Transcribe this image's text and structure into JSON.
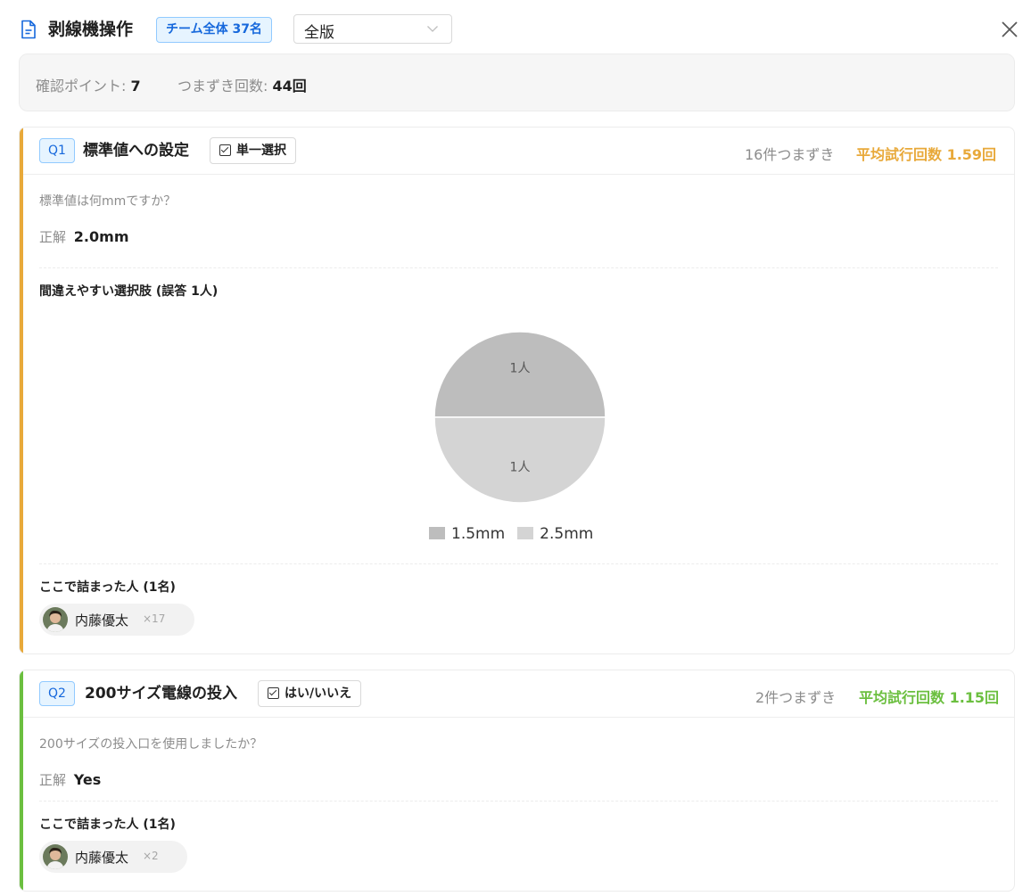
{
  "header": {
    "title": "剥線機操作",
    "team_badge": "チーム全体 37名",
    "version_select": {
      "selected": "全版"
    }
  },
  "summary": {
    "check_points_label": "確認ポイント:",
    "check_points_value": "7",
    "stumbles_label": "つまずき回数:",
    "stumbles_value": "44回"
  },
  "questions": [
    {
      "badge": "Q1",
      "title": "標準値への設定",
      "type_label": "単一選択",
      "stuck_count": "16件つまずき",
      "avg_attempts": "平均試行回数 1.59回",
      "accent_color": "#e8a93a",
      "question_text": "標準値は何mmですか？",
      "answer_label": "正解",
      "answer_value": "2.0mm",
      "confusing_title": "間違えやすい選択肢 (誤答 1人)",
      "stuck_people_title": "ここで詰まった人 (1名)",
      "people": [
        {
          "name": "内藤優太",
          "count": "×17"
        }
      ]
    },
    {
      "badge": "Q2",
      "title": "200サイズ電線の投入",
      "type_label": "はい/いいえ",
      "stuck_count": "2件つまずき",
      "avg_attempts": "平均試行回数 1.15回",
      "accent_color": "#6bbf3f",
      "question_text": "200サイズの投入口を使用しましたか？",
      "answer_label": "正解",
      "answer_value": "Yes",
      "stuck_people_title": "ここで詰まった人 (1名)",
      "people": [
        {
          "name": "内藤優太",
          "count": "×2"
        }
      ]
    }
  ],
  "chart_data": {
    "type": "pie",
    "categories": [
      "1.5mm",
      "2.5mm"
    ],
    "values": [
      1,
      1
    ],
    "data_labels": [
      "1人",
      "1人"
    ],
    "colors": [
      "#bdbdbd",
      "#d4d4d4"
    ],
    "legend": "bottom"
  }
}
